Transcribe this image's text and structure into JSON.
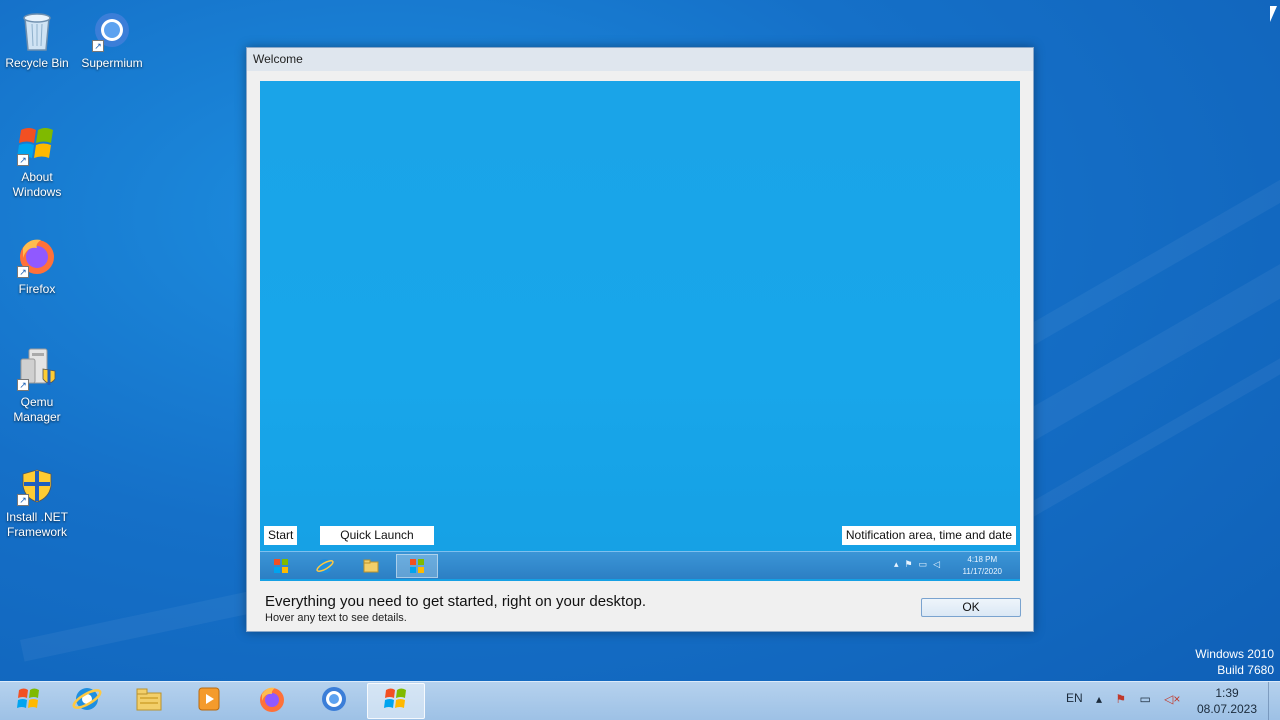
{
  "desktop": {
    "icons": [
      {
        "label": "Recycle Bin",
        "icon": "recycle-bin-icon"
      },
      {
        "label": "Supermium",
        "icon": "supermium-icon"
      },
      {
        "label": "About Windows",
        "icon": "windows-logo-icon"
      },
      {
        "label": "Firefox",
        "icon": "firefox-icon"
      },
      {
        "label": "Qemu Manager",
        "icon": "qemu-manager-icon"
      },
      {
        "label": "Install .NET Framework",
        "icon": "shield-installer-icon"
      }
    ]
  },
  "welcome_window": {
    "title": "Welcome",
    "preview": {
      "start_label": "Start",
      "quick_launch_label": "Quick Launch",
      "notification_label": "Notification area, time and date",
      "mini_time": "4:18 PM",
      "mini_date": "11/17/2020"
    },
    "message": "Everything you need to get started, right on your desktop.",
    "hint": "Hover any text to see details.",
    "ok_label": "OK"
  },
  "watermark": {
    "line1": "Windows 2010",
    "line2": "Build 7680"
  },
  "taskbar": {
    "buttons": [
      {
        "icon": "start-orb-icon"
      },
      {
        "icon": "internet-explorer-icon"
      },
      {
        "icon": "file-explorer-icon"
      },
      {
        "icon": "media-player-icon"
      },
      {
        "icon": "firefox-icon"
      },
      {
        "icon": "supermium-icon"
      },
      {
        "icon": "welcome-app-icon",
        "active": true
      }
    ],
    "language": "EN",
    "time": "1:39",
    "date": "08.07.2023"
  }
}
